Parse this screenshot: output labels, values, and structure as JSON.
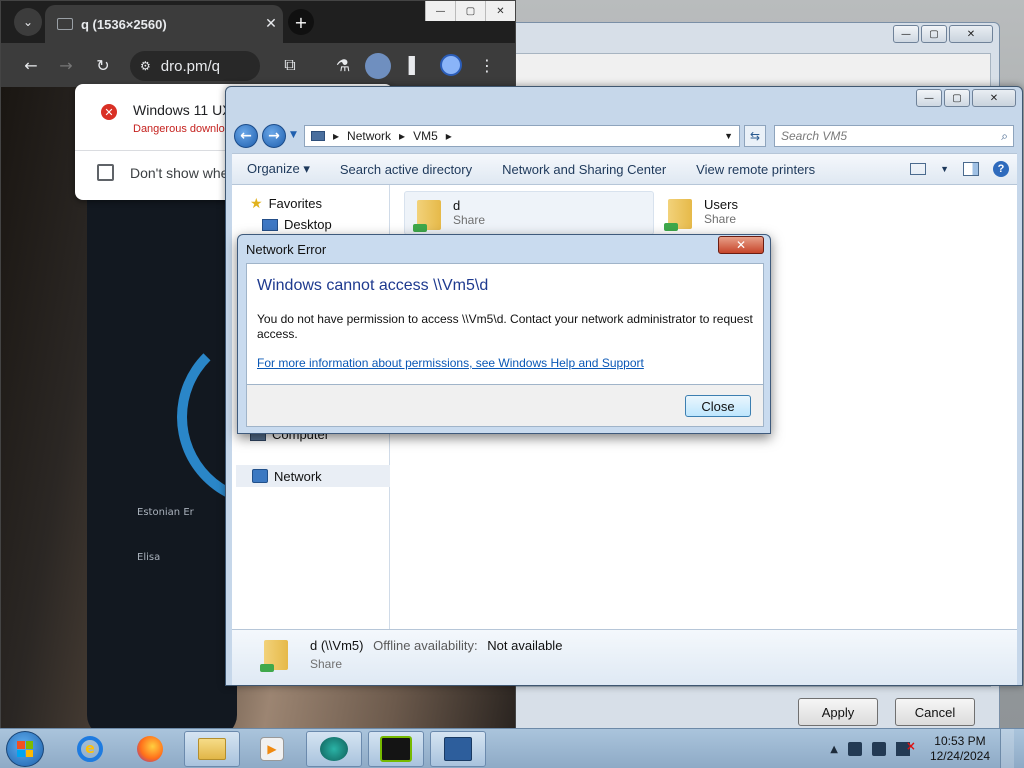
{
  "chrome": {
    "tab_title": "q (1536×2560)",
    "url": "dro.pm/q",
    "download": {
      "filename": "Windows 11 UX",
      "warning": "Dangerous downlo",
      "dont_show": "Don't show whe"
    },
    "phone_networks": [
      "Estonian Er",
      "Elisa"
    ]
  },
  "explorer": {
    "breadcrumb": [
      "Network",
      "VM5"
    ],
    "search_placeholder": "Search VM5",
    "commands": [
      "Organize ▾",
      "Search active directory",
      "Network and Sharing Center",
      "View remote printers"
    ],
    "nav": {
      "favorites": "Favorites",
      "desktop": "Desktop",
      "computer": "Computer",
      "network": "Network"
    },
    "shares": [
      {
        "name": "d",
        "type": "Share"
      },
      {
        "name": "Users",
        "type": "Share"
      }
    ],
    "details": {
      "name": "d (\\\\Vm5)",
      "offline_label": "Offline availability:",
      "offline_value": "Not available",
      "type": "Share"
    }
  },
  "dialog": {
    "title": "Network Error",
    "headline": "Windows cannot access \\\\Vm5\\d",
    "message": "You do not have permission to access \\\\Vm5\\d. Contact your network administrator to request access.",
    "link": "For more information about permissions, see Windows Help and Support",
    "close_button": "Close"
  },
  "background_dialog": {
    "apply": "Apply",
    "cancel": "Cancel"
  },
  "taskbar": {
    "time": "10:53 PM",
    "date": "12/24/2024"
  }
}
